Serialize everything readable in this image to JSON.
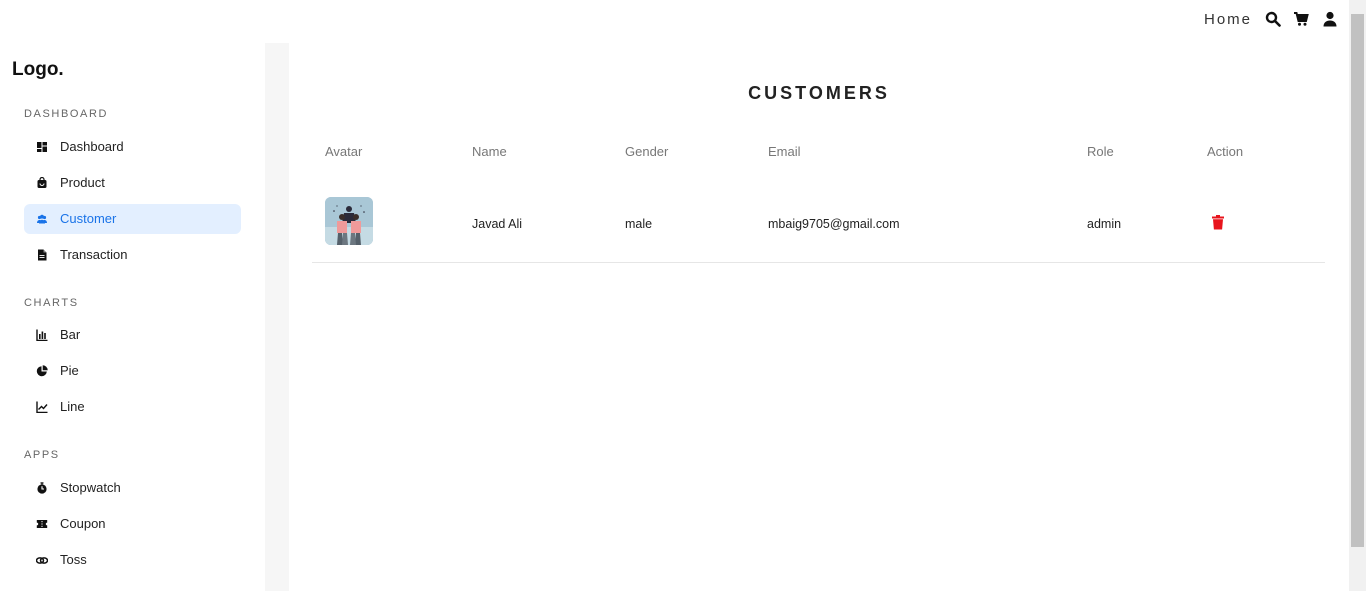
{
  "topbar": {
    "home_label": "Home",
    "icons": [
      "search-icon",
      "cart-icon",
      "user-icon"
    ]
  },
  "sidebar": {
    "logo": "Logo.",
    "sections": [
      {
        "title": "DASHBOARD",
        "items": [
          {
            "label": "Dashboard",
            "icon": "dashboard-icon",
            "active": false
          },
          {
            "label": "Product",
            "icon": "bag-icon",
            "active": false
          },
          {
            "label": "Customer",
            "icon": "people-icon",
            "active": true
          },
          {
            "label": "Transaction",
            "icon": "document-icon",
            "active": false
          }
        ]
      },
      {
        "title": "CHARTS",
        "items": [
          {
            "label": "Bar",
            "icon": "bar-chart-icon",
            "active": false
          },
          {
            "label": "Pie",
            "icon": "pie-chart-icon",
            "active": false
          },
          {
            "label": "Line",
            "icon": "line-chart-icon",
            "active": false
          }
        ]
      },
      {
        "title": "APPS",
        "items": [
          {
            "label": "Stopwatch",
            "icon": "stopwatch-icon",
            "active": false
          },
          {
            "label": "Coupon",
            "icon": "coupon-icon",
            "active": false
          },
          {
            "label": "Toss",
            "icon": "coin-toss-icon",
            "active": false
          }
        ]
      }
    ]
  },
  "main": {
    "title": "CUSTOMERS",
    "table": {
      "headers": [
        "Avatar",
        "Name",
        "Gender",
        "Email",
        "Role",
        "Action"
      ],
      "rows": [
        {
          "name": "Javad Ali",
          "gender": "male",
          "email": "mbaig9705@gmail.com",
          "role": "admin",
          "action_icon": "trash-icon"
        }
      ]
    }
  },
  "colors": {
    "accent": "#1a73e8",
    "active_bg": "#e3efff",
    "delete": "#e8141c",
    "gutter": "#f6f6f6"
  }
}
